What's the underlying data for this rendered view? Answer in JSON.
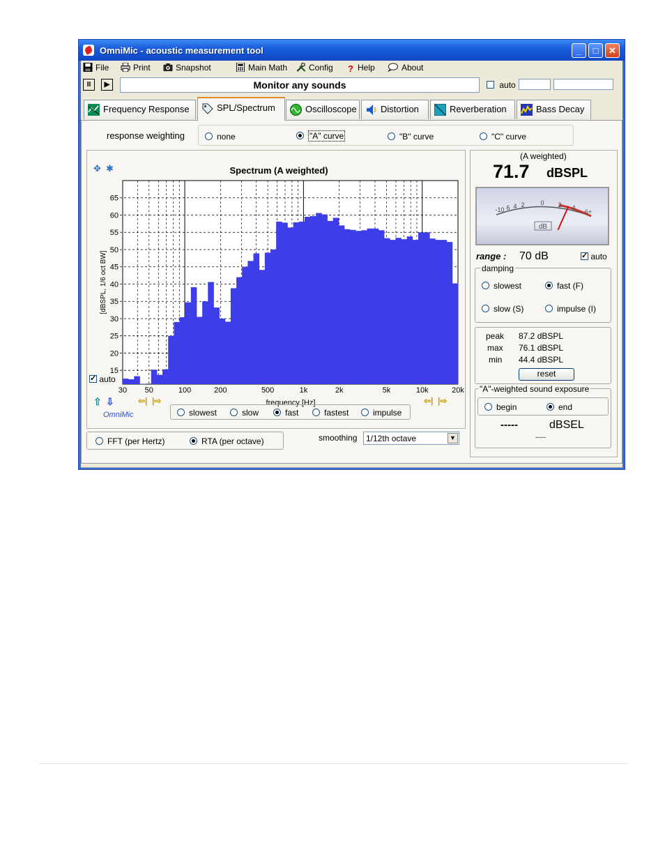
{
  "window": {
    "title": "OmniMic - acoustic measurement tool"
  },
  "menu": [
    {
      "label": "File",
      "icon": "floppy-icon"
    },
    {
      "label": "Print",
      "icon": "printer-icon"
    },
    {
      "label": "Snapshot",
      "icon": "camera-icon"
    },
    {
      "label": "Main Math",
      "icon": "calculator-icon"
    },
    {
      "label": "Config",
      "icon": "tools-icon"
    },
    {
      "label": "Help",
      "icon": "question-icon"
    },
    {
      "label": "About",
      "icon": "speech-bubble-icon"
    }
  ],
  "toolbar": {
    "pause_symbol": "II",
    "play_symbol": "▶",
    "monitor_text": "Monitor any sounds",
    "auto_label": "auto"
  },
  "tabs": [
    "Frequency Response",
    "SPL/Spectrum",
    "Oscilloscope",
    "Distortion",
    "Reverberation",
    "Bass Decay"
  ],
  "weighting": {
    "label": "response weighting",
    "options": [
      "none",
      "\"A\" curve",
      "\"B\" curve",
      "\"C\" curve"
    ],
    "selected": 1
  },
  "chart_data": {
    "type": "bar",
    "title": "Spectrum (A weighted)",
    "xlabel": "frequency [Hz]",
    "ylabel": "[dBSPL, 1/6 oct BW]",
    "x_scale": "log",
    "xlim": [
      30,
      20000
    ],
    "ylim": [
      11,
      70
    ],
    "x_ticks": [
      "30",
      "50",
      "100",
      "200",
      "500",
      "1k",
      "2k",
      "5k",
      "10k",
      "20k"
    ],
    "y_ticks": [
      "15",
      "20",
      "25",
      "30",
      "35",
      "40",
      "45",
      "50",
      "55",
      "60",
      "65"
    ],
    "grid": true,
    "color": "#3e3ee8",
    "values": [
      12.6,
      12.4,
      13.3,
      11.1,
      11.0,
      15.2,
      13.7,
      15.3,
      25.0,
      29.0,
      30.4,
      34.7,
      39.1,
      30.5,
      35.0,
      40.6,
      33.2,
      30.0,
      29.1,
      38.8,
      42.0,
      45.0,
      46.7,
      48.9,
      44.1,
      49.1,
      50.0,
      58.1,
      57.8,
      56.4,
      57.9,
      58.1,
      59.5,
      59.7,
      60.6,
      60.2,
      58.3,
      59.2,
      57.0,
      55.9,
      55.7,
      55.4,
      55.6,
      56.1,
      56.1,
      55.6,
      53.3,
      52.8,
      53.4,
      53.0,
      53.8,
      52.8,
      55.0,
      55.0,
      53.2,
      52.8,
      52.8,
      52.2,
      40.2
    ]
  },
  "plot": {
    "auto_label": "auto",
    "logo": "OmniMic",
    "speed_options": [
      "slowest",
      "slow",
      "fast",
      "fastest",
      "impulse"
    ],
    "speed_selected": 2
  },
  "mode": {
    "options": [
      "FFT (per Hertz)",
      "RTA (per octave)"
    ],
    "selected": 1
  },
  "smoothing": {
    "label": "smoothing",
    "value": "1/12th octave"
  },
  "meter": {
    "weighting_note": "(A weighted)",
    "value": "71.7",
    "unit": "dBSPL",
    "scale_labels": [
      "-10",
      "6",
      "4",
      "2",
      "0",
      "2",
      "4",
      "6+"
    ],
    "meter_label": "dB",
    "needle_level": 1.5,
    "range_label": "range :",
    "range_value": "70 dB",
    "range_auto": "auto"
  },
  "damping": {
    "label": "damping",
    "options": [
      "slowest",
      "fast (F)",
      "slow (S)",
      "impulse (I)"
    ],
    "selected": 1
  },
  "stats": {
    "peak_label": "peak",
    "peak_value": "87.2 dBSPL",
    "max_label": "max",
    "max_value": "76.1 dBSPL",
    "min_label": "min",
    "min_value": "44.4 dBSPL",
    "reset_label": "reset"
  },
  "exposure": {
    "label": "\"A\"-weighted sound exposure",
    "begin_label": "begin",
    "end_label": "end",
    "selected": "end",
    "value": "-----",
    "unit": "dBSEL",
    "sub_value": "-----"
  }
}
